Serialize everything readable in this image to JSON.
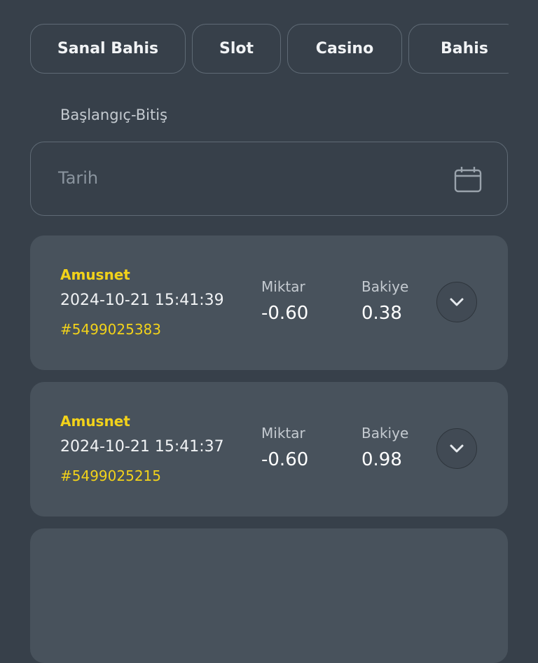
{
  "tabs": [
    {
      "label": "Sanal Bahis"
    },
    {
      "label": "Slot"
    },
    {
      "label": "Casino"
    },
    {
      "label": "Bahis"
    }
  ],
  "filter": {
    "range_label": "Başlangıç-Bitiş",
    "date_placeholder": "Tarih",
    "icon": "calendar-icon"
  },
  "columns": {
    "amount": "Miktar",
    "balance": "Bakiye"
  },
  "transactions": [
    {
      "provider": "Amusnet",
      "datetime": "2024-10-21 15:41:39",
      "id": "#5499025383",
      "amount": "-0.60",
      "balance": "0.38"
    },
    {
      "provider": "Amusnet",
      "datetime": "2024-10-21 15:41:37",
      "id": "#5499025215",
      "amount": "-0.60",
      "balance": "0.98"
    }
  ],
  "colors": {
    "background": "#37404a",
    "card": "#48525c",
    "accent_yellow": "#f2d21a",
    "border": "#5f6a75"
  }
}
